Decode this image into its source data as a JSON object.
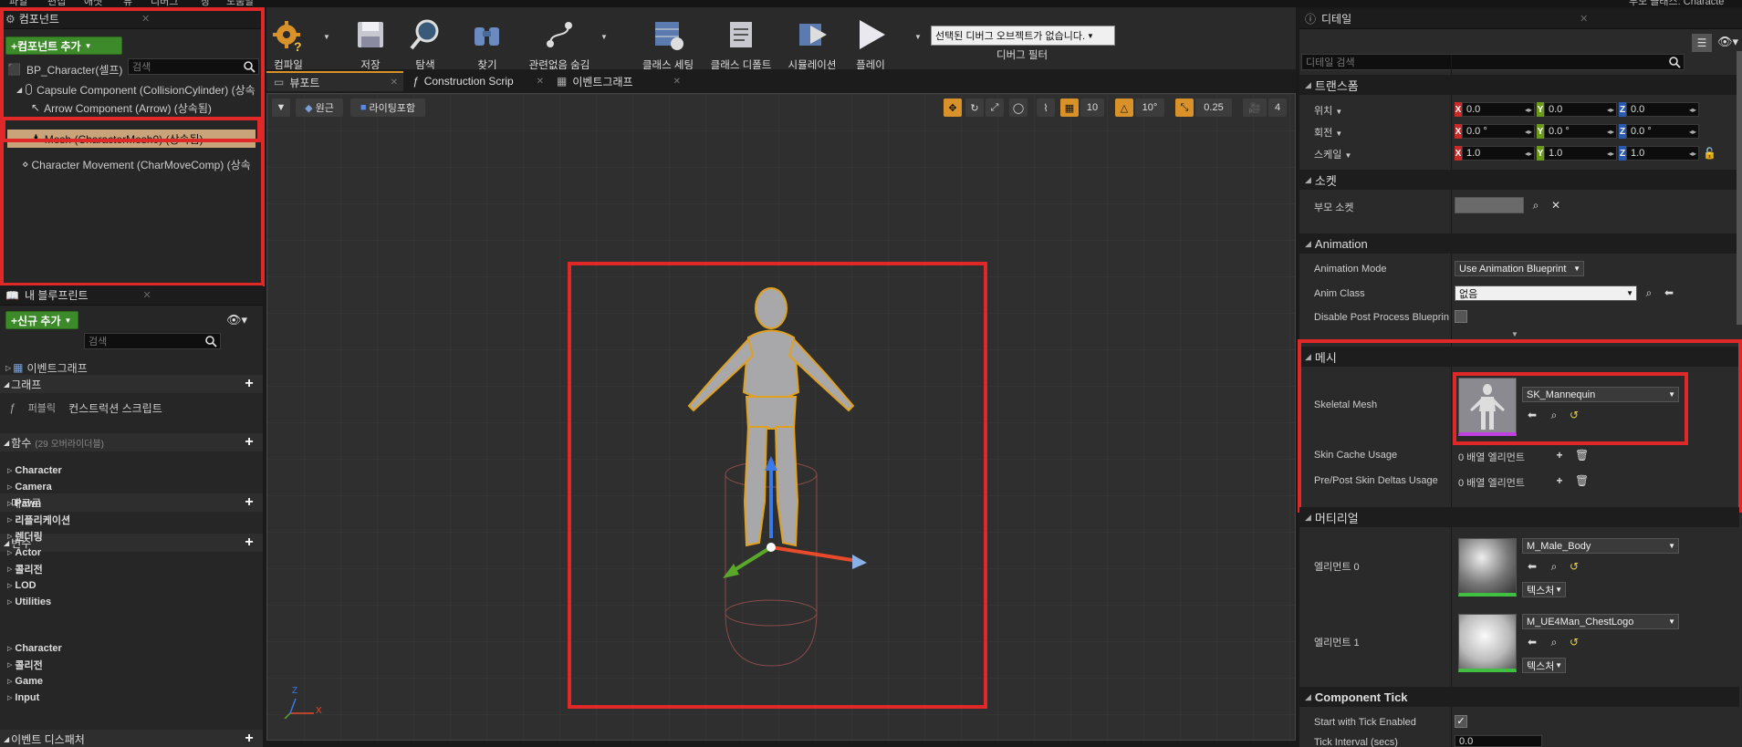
{
  "menu": {
    "items": [
      "파일",
      "편집",
      "애셋",
      "뷰",
      "디버그",
      "창",
      "도움말"
    ],
    "right_text": "부모 클래스: Characte"
  },
  "components": {
    "tab_title": "컴포넌트",
    "add_button": "+컴포넌트 추가",
    "search_placeholder": "검색",
    "tree": [
      "BP_Character(셀프)",
      "Capsule Component (CollisionCylinder) (상속",
      "Arrow Component (Arrow) (상속됨)",
      "Mesh (CharacterMesh0) (상속됨)",
      "Character Movement (CharMoveComp) (상속"
    ]
  },
  "blueprint": {
    "tab_title": "내 블루프린트",
    "add_button": "+신규 추가",
    "search_placeholder": "검색",
    "graph_header": "그래프",
    "event_graph": "이벤트그래프",
    "functions_header": "함수",
    "functions_override": "(29 오버라이더블)",
    "construction_public": "퍼블릭",
    "construction_label": "컨스트럭션 스크립트",
    "macros_header": "매크로",
    "variables_header": "변수",
    "variables": [
      "Character",
      "Camera",
      "Pawn",
      "리플리케이션",
      "렌더링",
      "Actor",
      "콜리전",
      "LOD",
      "Utilities"
    ],
    "dispatchers_header": "이벤트 디스패처",
    "dispatchers": [
      "Character",
      "콜리전",
      "Game",
      "Input"
    ]
  },
  "toolbar": {
    "compile": "컴파일",
    "save": "저장",
    "browse": "탐색",
    "find": "찾기",
    "hide_unrelated": "관련없음 숨김",
    "class_settings": "클래스 세팅",
    "class_defaults": "클래스 디폴트",
    "simulation": "시뮬레이션",
    "play": "플레이",
    "debug_object": "선택된 디버그 오브젝트가 없습니다.",
    "debug_filter": "디버그 필터"
  },
  "editor_tabs": [
    "뷰포트",
    "Construction Scrip",
    "이벤트그래프"
  ],
  "viewport": {
    "perspective": "원근",
    "lighting": "라이팅포함",
    "grid_snap": "10",
    "rot_snap": "10°",
    "scale_snap": "0.25",
    "cam_speed": "4",
    "axis_x": "X",
    "axis_z": "Z"
  },
  "details": {
    "tab_title": "디테일",
    "search_placeholder": "디테일 검색",
    "transform": {
      "header": "트랜스폼",
      "location_label": "위치",
      "rotation_label": "회전",
      "scale_label": "스케일",
      "location": [
        "0.0",
        "0.0",
        "0.0"
      ],
      "rotation": [
        "0.0 °",
        "0.0 °",
        "0.0 °"
      ],
      "scale": [
        "1.0",
        "1.0",
        "1.0"
      ]
    },
    "socket": {
      "header": "소켓",
      "parent_socket": "부모 소켓"
    },
    "animation": {
      "header": "Animation",
      "mode_label": "Animation Mode",
      "mode_value": "Use Animation Blueprint",
      "class_label": "Anim Class",
      "class_value": "없음",
      "disable_label": "Disable Post Process Blueprin"
    },
    "mesh": {
      "header": "메시",
      "skeletal_label": "Skeletal Mesh",
      "skeletal_value": "SK_Mannequin",
      "skin_cache_label": "Skin Cache Usage",
      "skin_cache_value": "0 배열 엘리먼트",
      "pre_post_label": "Pre/Post Skin Deltas Usage",
      "pre_post_value": "0 배열 엘리먼트"
    },
    "materials": {
      "header": "머티리얼",
      "el0_label": "엘리먼트 0",
      "el0_value": "M_Male_Body",
      "el0_tex": "텍스처",
      "el1_label": "엘리먼트 1",
      "el1_value": "M_UE4Man_ChestLogo",
      "el1_tex": "텍스처"
    },
    "tick": {
      "header": "Component Tick",
      "start_label": "Start with Tick Enabled",
      "interval_label": "Tick Interval (secs)",
      "interval_value": "0.0"
    }
  },
  "colors": {
    "accent_red": "#e02828",
    "selection": "#c9a37a",
    "green": "#3d8a2a"
  }
}
